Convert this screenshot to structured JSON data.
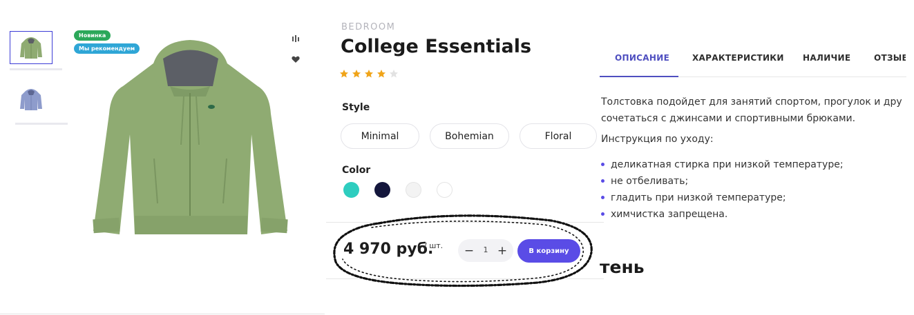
{
  "thumbnails": [
    {
      "alt": "green-hoodie-thumb"
    },
    {
      "alt": "blue-hoodie-thumb"
    }
  ],
  "badges": {
    "new": "Новинка",
    "recommended": "Мы рекомендуем"
  },
  "product": {
    "category": "BEDROOM",
    "title": "College Essentials",
    "rating": 4,
    "rating_max": 5,
    "style_label": "Style",
    "styles": [
      "Minimal",
      "Bohemian",
      "Floral"
    ],
    "color_label": "Color",
    "colors": [
      "#2ecdbf",
      "#14163c",
      "#f3f3f3",
      "#ffffff"
    ],
    "price": "4 970 руб.",
    "unit": "/ шт.",
    "quantity": "1",
    "qty_minus": "−",
    "qty_plus": "+",
    "add_to_cart": "В корзину"
  },
  "tabs": [
    "ОПИСАНИЕ",
    "ХАРАКТЕРИСТИКИ",
    "НАЛИЧИЕ",
    "ОТЗЫВ"
  ],
  "description": {
    "lines": [
      "Толстовка подойдет для занятий спортом, прогулок и дру",
      "сочетаться с джинсами и спортивными брюками."
    ],
    "care_title": "Инструкция по уходу:",
    "care_items": [
      "деликатная стирка при низкой температуре;",
      "не отбеливать;",
      "гладить при низкой температуре;",
      "химчистка запрещена."
    ]
  },
  "cut_heading": "тень",
  "theme": {
    "accent": "#5a4ce6",
    "tab_active": "#4f4fc0",
    "star": "#f0a419",
    "star_empty": "#e2e2e2",
    "badge_new": "#2ca85a",
    "badge_rec": "#2fa6d6",
    "hoodie_green": "#8fab72"
  }
}
